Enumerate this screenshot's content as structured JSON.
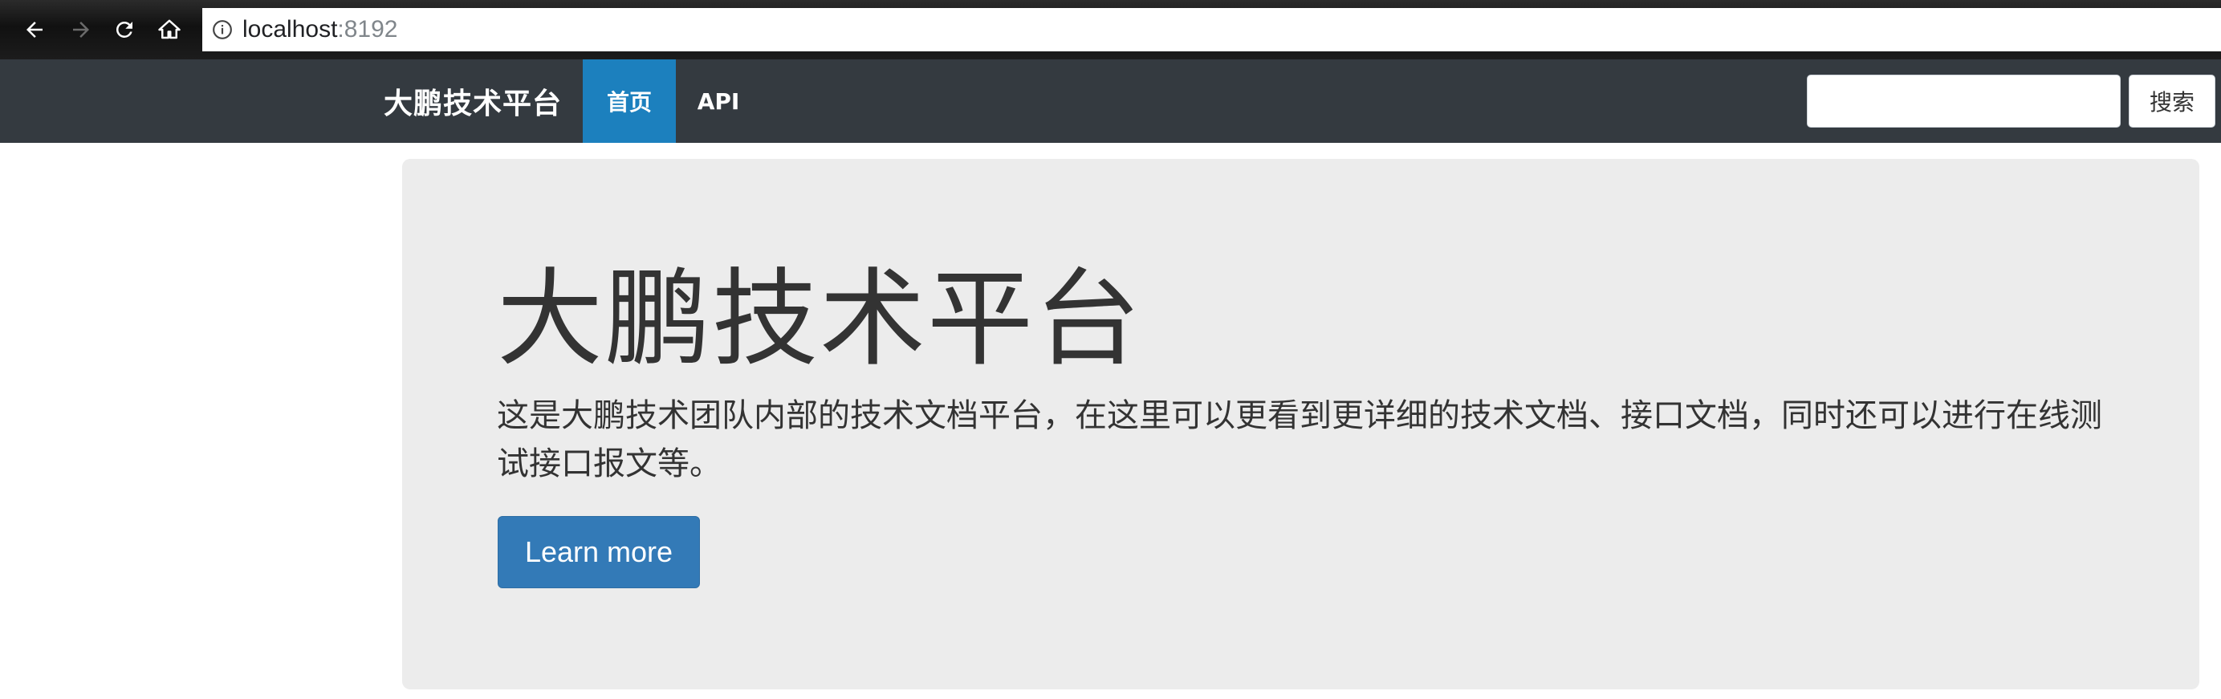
{
  "browser": {
    "url_host": "localhost",
    "url_port": ":8192",
    "back_icon": "arrow-left-icon",
    "forward_icon": "arrow-right-icon",
    "reload_icon": "reload-icon",
    "home_icon": "home-icon",
    "info_icon": "info-icon"
  },
  "navbar": {
    "brand": "大鹏技术平台",
    "items": [
      {
        "label": "首页",
        "active": true
      },
      {
        "label": "API",
        "active": false
      }
    ],
    "search": {
      "value": "",
      "placeholder": "",
      "button_label": "搜索"
    },
    "colors": {
      "background": "#343a40",
      "active": "#1c80be"
    }
  },
  "hero": {
    "title": "大鹏技术平台",
    "description": "这是大鹏技术团队内部的技术文档平台，在这里可以更看到更详细的技术文档、接口文档，同时还可以进行在线测试接口报文等。",
    "button_label": "Learn more",
    "colors": {
      "background": "#ececec",
      "button": "#337ab7"
    }
  }
}
